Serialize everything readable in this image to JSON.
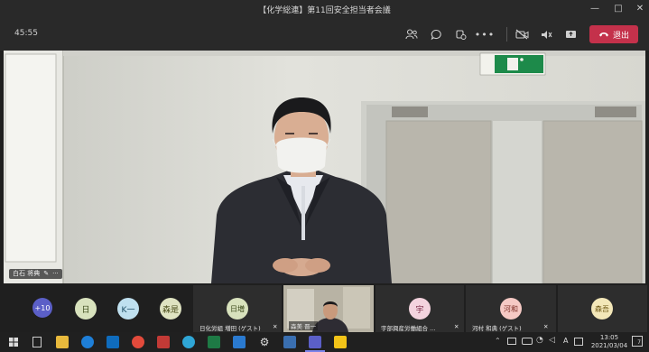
{
  "window": {
    "title": "【化学総連】第11回安全担当者会議"
  },
  "toolbar": {
    "timer": "45:55",
    "leave_label": "退出"
  },
  "main_video": {
    "name_label": "白石 将典"
  },
  "strip": {
    "overflow_count": "+10",
    "avatars": [
      {
        "initial": "日",
        "bg": "#d8e2bd",
        "fg": "#3b4a1a"
      },
      {
        "initial": "K一",
        "bg": "#bfe0ef",
        "fg": "#1f4f66"
      },
      {
        "initial": "森是",
        "bg": "#dfe3c1",
        "fg": "#4a4d1a"
      }
    ],
    "tiles": [
      {
        "initial": "日増",
        "name": "日化労組 増田 (ゲスト)",
        "bg": "#d8e2bd",
        "fg": "#3b4a1a"
      },
      {
        "name": "森美 晋一"
      },
      {
        "initial": "宇",
        "name": "宇部興産労働組合 ...",
        "bg": "#f3d3de",
        "fg": "#7a2a46"
      },
      {
        "initial": "河和",
        "name": "河村 和典 (ゲスト)",
        "bg": "#f5c9c4",
        "fg": "#7a2a22"
      },
      {
        "initial": "森吾",
        "bg": "#f3e7b8",
        "fg": "#6b5410"
      }
    ]
  },
  "taskbar": {
    "time": "13:05",
    "date": "2021/03/04",
    "ime": "A",
    "notif": "7"
  },
  "colors": {
    "leave": "#c4314b",
    "overflow": "#5b5fc7"
  },
  "icons": [
    "participants-icon",
    "chat-icon",
    "reactions-icon",
    "more-icon",
    "camera-off-icon",
    "mic-off-icon",
    "share-icon",
    "phone-icon"
  ]
}
